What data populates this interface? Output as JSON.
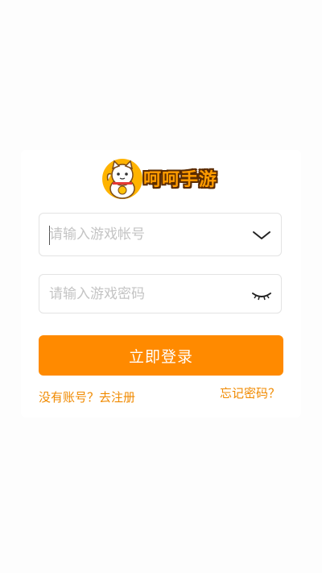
{
  "logo": {
    "text": "呵呵手游"
  },
  "account": {
    "placeholder": "请输入游戏帐号",
    "value": ""
  },
  "password": {
    "placeholder": "请输入游戏密码",
    "value": ""
  },
  "login": {
    "label": "立即登录"
  },
  "links": {
    "register": "没有账号？去注册",
    "forgot": "忘记密码？"
  },
  "colors": {
    "accent": "#ff8a00",
    "link": "#f08a00",
    "border": "#e3e3e3"
  },
  "icons": {
    "account_dropdown": "chevron-down-icon",
    "password_toggle": "eye-closed-icon"
  }
}
